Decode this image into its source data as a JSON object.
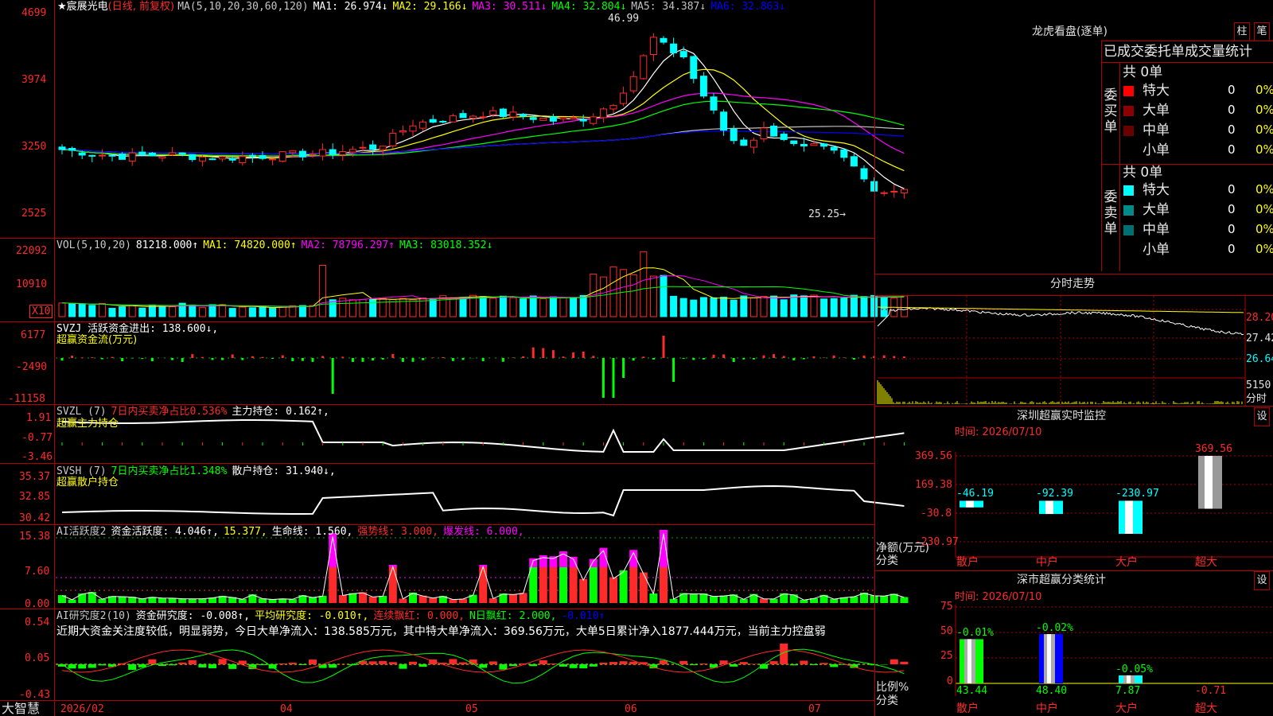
{
  "app": {
    "logo_text": "大智慧"
  },
  "stock": {
    "name": "★宸展光电",
    "mode": "(日线, 前复权)"
  },
  "colors": {
    "up": "#ff2a2a",
    "down": "#00ffff",
    "grid": "#b00000",
    "ma1": "#ffffff",
    "ma2": "#ffff00",
    "ma3": "#ff00ff",
    "ma4": "#00ff00",
    "ma5": "#c0c0c0",
    "ma6": "#0000ff"
  },
  "price_panel": {
    "y_labels": [
      "4699",
      "3974",
      "3250",
      "2525"
    ],
    "legend": [
      {
        "text": "MA(5,10,20,30,60,120)",
        "color": "#c8c8c8"
      },
      {
        "text": "MA1: 26.974↓",
        "color": "#ffffff"
      },
      {
        "text": "MA2: 29.166↓",
        "color": "#ffff00"
      },
      {
        "text": "MA3: 30.511↓",
        "color": "#ff00ff"
      },
      {
        "text": "MA4: 32.804↓",
        "color": "#00ff00"
      },
      {
        "text": "MA5: 34.387↓",
        "color": "#c0c0c0"
      },
      {
        "text": "MA6: 32.863↓",
        "color": "#0000ff"
      }
    ],
    "high_label": "46.99",
    "low_label": "25.25→"
  },
  "vol_panel": {
    "y_labels": [
      "22092",
      "10910"
    ],
    "unit_box": "X10",
    "legend": [
      {
        "text": "VOL(5,10,20)",
        "color": "#c8c8c8"
      },
      {
        "text": "81218.000↑",
        "color": "#ffffff"
      },
      {
        "text": "MA1: 74820.000↑",
        "color": "#ffff00"
      },
      {
        "text": "MA2: 78796.297↑",
        "color": "#ff00ff"
      },
      {
        "text": "MA3: 83018.352↓",
        "color": "#00ff00"
      }
    ]
  },
  "svzj_panel": {
    "y_labels": [
      "6177",
      "-2490",
      "-11158"
    ],
    "legend": [
      {
        "text": "SVZJ  活跃资金进出: 138.600↓,",
        "color": "#ffffff"
      }
    ],
    "subtitle": "超赢资金流(万元)"
  },
  "svzl_panel": {
    "y_labels": [
      "1.91",
      "-0.77",
      "-3.46"
    ],
    "legend": [
      {
        "text": "SVZL (7)",
        "color": "#c8c8c8"
      },
      {
        "text": "7日内买卖净占比0.536%",
        "color": "#ff2a2a"
      },
      {
        "text": "主力持仓: 0.162↑,",
        "color": "#ffffff"
      }
    ],
    "subtitle": "超赢主力持仓"
  },
  "svsh_panel": {
    "y_labels": [
      "35.37",
      "32.85",
      "30.42"
    ],
    "legend": [
      {
        "text": "SVSH (7)",
        "color": "#c8c8c8"
      },
      {
        "text": "7日内买卖净占比1.348%",
        "color": "#00ff00"
      },
      {
        "text": "散户持仓: 31.940↓,",
        "color": "#ffffff"
      }
    ],
    "subtitle": "超赢散户持仓"
  },
  "ai_panel": {
    "y_labels": [
      "15.38",
      "7.60",
      "0.00"
    ],
    "legend": [
      {
        "text": "AI活跃度2",
        "color": "#c8c8c8"
      },
      {
        "text": "资金活跃度: 4.046↑,",
        "color": "#ffffff"
      },
      {
        "text": "15.377,",
        "color": "#ffff00"
      },
      {
        "text": "生命线: 1.560,",
        "color": "#ffffff"
      },
      {
        "text": "强势线: 3.000,",
        "color": "#ff2a2a"
      },
      {
        "text": "爆发线: 6.000,",
        "color": "#ff00ff"
      }
    ]
  },
  "research_panel": {
    "y_labels": [
      "0.54",
      "0.05",
      "-0.43"
    ],
    "legend": [
      {
        "text": "AI研究度2(10)",
        "color": "#c8c8c8"
      },
      {
        "text": "资金研究度: -0.008↑,",
        "color": "#ffffff"
      },
      {
        "text": "平均研究度: -0.010↑,",
        "color": "#ffff00"
      },
      {
        "text": "连续飘红: 0.000,",
        "color": "#ff2a2a"
      },
      {
        "text": "N日飘红: 2.000,",
        "color": "#00ff00"
      },
      {
        "text": "-0.010↑",
        "color": "#0000ff"
      }
    ],
    "comment": "近期大资金关注度较低，明显弱势，今日大单净流入：138.585万元，其中特大单净流入：369.56万元，大单5日累计净入1877.444万元，当前主力控盘弱"
  },
  "x_axis": {
    "labels": [
      "2026/02",
      "04",
      "05",
      "06",
      "07"
    ]
  },
  "right": {
    "lhb": {
      "title": "龙虎看盘(逐单)",
      "btn_zhu": "柱",
      "btn_bi": "笔",
      "header": "已成交委托单成交量统计",
      "buy": {
        "side_label": "委买单",
        "total": "共 0单",
        "rows": [
          {
            "label": "特大",
            "count": "0",
            "pct": "0%",
            "color": "#ff0000"
          },
          {
            "label": "大单",
            "count": "0",
            "pct": "0%",
            "color": "#8b0000"
          },
          {
            "label": "中单",
            "count": "0",
            "pct": "0%",
            "color": "#6a0000"
          },
          {
            "label": "小单",
            "count": "0",
            "pct": "0%",
            "color": "#000000"
          }
        ]
      },
      "sell": {
        "side_label": "委卖单",
        "total": "共 0单",
        "rows": [
          {
            "label": "特大",
            "count": "0",
            "pct": "0%",
            "color": "#00ffff"
          },
          {
            "label": "大单",
            "count": "0",
            "pct": "0%",
            "color": "#008b8b"
          },
          {
            "label": "中单",
            "count": "0",
            "pct": "0%",
            "color": "#007070"
          },
          {
            "label": "小单",
            "count": "0",
            "pct": "0%",
            "color": "#000000"
          }
        ]
      }
    },
    "fenshi": {
      "title": "分时走势",
      "y_labels": [
        "28.20",
        "27.42",
        "26.64"
      ],
      "vol_label": "5150",
      "fs_label": "分时"
    },
    "sz_monitor": {
      "title": "深圳超赢实时监控",
      "set": "设",
      "date": "时间: 2026/07/10",
      "y_labels": [
        "369.56",
        "169.38",
        "-30.8",
        "-230.97"
      ],
      "y_title": "净额(万元)",
      "x_title": "分类",
      "bars": [
        {
          "cat": "散户",
          "value": -46.19,
          "label": "-46.19"
        },
        {
          "cat": "中户",
          "value": -92.39,
          "label": "-92.39"
        },
        {
          "cat": "大户",
          "value": -230.97,
          "label": "-230.97"
        },
        {
          "cat": "超大",
          "value": 369.56,
          "label": "369.56"
        }
      ]
    },
    "sz_class": {
      "title": "深市超赢分类统计",
      "set": "设",
      "date": "时间: 2026/07/10",
      "y_labels": [
        "75",
        "50",
        "25",
        "0"
      ],
      "y_title": "比例%",
      "x_title": "分类",
      "bars": [
        {
          "cat": "散户",
          "value": 43.44,
          "label": "43.44",
          "chg": "-0.01%"
        },
        {
          "cat": "中户",
          "value": 48.4,
          "label": "48.40",
          "chg": "-0.02%"
        },
        {
          "cat": "大户",
          "value": 7.87,
          "label": "7.87",
          "chg": "-0.05%"
        },
        {
          "cat": "超大",
          "value": -0.71,
          "label": "-0.71",
          "chg": ""
        }
      ]
    }
  }
}
